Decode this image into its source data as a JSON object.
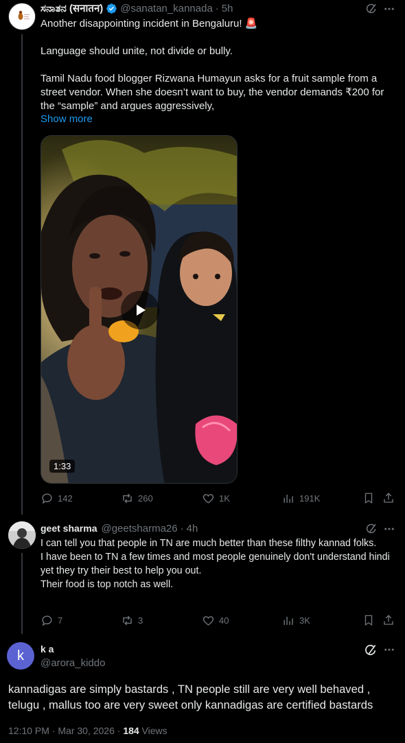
{
  "post1": {
    "author_name": "ಸನಾತನ (सनातन)",
    "handle": "@sanatan_kannada",
    "dot": "·",
    "time": "5h",
    "text": "Another disappointing incident in Bengaluru! 🚨\n\nLanguage should unite, not divide or bully.\n\nTamil Nadu food blogger Rizwana Humayun asks for a fruit sample from a street vendor. When she doesn’t want to buy, the vendor demands ₹200 for the “sample” and argues aggressively,",
    "show_more": "Show more",
    "video_duration": "1:33",
    "replies": "142",
    "reposts": "260",
    "likes": "1K",
    "views": "191K",
    "colors": {
      "verified": "#1d9bf0",
      "link": "#1d9bf0"
    }
  },
  "post2": {
    "author_name": "geet sharma",
    "handle": "@geetsharma26",
    "dot": "·",
    "time": "4h",
    "text": "I can tell you that people in TN are much better than these filthy kannad folks.\nI have been to TN a few times and most people genuinely don't understand hindi yet they try their best to help you out.\nTheir food is top notch as well.",
    "replies": "7",
    "reposts": "3",
    "likes": "40",
    "views": "3K"
  },
  "post3": {
    "avatar_letter": "k",
    "author_name": "k a",
    "handle": "@arora_kiddo",
    "text": "kannadigas are simply bastards , TN people still are very well behaved , telugu , mallus too are very sweet only kannadigas are certified bastards",
    "timestamp": "12:10 PM · Mar 30, 2026 · ",
    "views_count": "184",
    "views_label": " Views",
    "colors": {
      "avatar_bg": "#5b63d3"
    }
  }
}
